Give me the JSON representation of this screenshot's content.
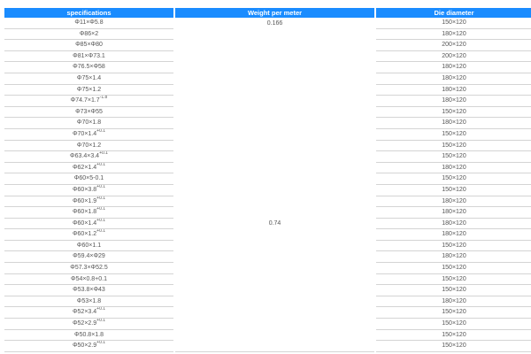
{
  "table": {
    "headers": [
      "specifications",
      "Weight per meter",
      "Die diameter"
    ],
    "rows": [
      {
        "spec": "Φ11×Φ5.8",
        "sup": "",
        "weight": "0.166",
        "die": "150×120"
      },
      {
        "spec": "Φ86×2",
        "sup": "",
        "weight": "",
        "die": "180×120"
      },
      {
        "spec": "Φ85×Φ80",
        "sup": "",
        "weight": "",
        "die": "200×120"
      },
      {
        "spec": "Φ81×Φ73.1",
        "sup": "",
        "weight": "",
        "die": "200×120"
      },
      {
        "spec": "Φ76.5×Φ58",
        "sup": "",
        "weight": "",
        "die": "180×120"
      },
      {
        "spec": "Φ75×1.4",
        "sup": "",
        "weight": "",
        "die": "180×120"
      },
      {
        "spec": "Φ75×1.2",
        "sup": "",
        "weight": "",
        "die": "180×120"
      },
      {
        "spec": "Φ74.7×1.7",
        "sup": "-1.8",
        "weight": "",
        "die": "180×120"
      },
      {
        "spec": "Φ73×Φ55",
        "sup": "",
        "weight": "",
        "die": "150×120"
      },
      {
        "spec": "Φ70×1.8",
        "sup": "",
        "weight": "",
        "die": "180×120"
      },
      {
        "spec": "Φ70×1.4",
        "sup": "+0.1",
        "weight": "",
        "die": "150×120"
      },
      {
        "spec": "Φ70×1.2",
        "sup": "",
        "weight": "",
        "die": "150×120"
      },
      {
        "spec": "Φ63.4×3.4",
        "sup": "+0.1",
        "weight": "",
        "die": "150×120"
      },
      {
        "spec": "Φ62×1.4",
        "sup": "+0.1",
        "weight": "",
        "die": "180×120"
      },
      {
        "spec": "Φ60×5-0.1",
        "sup": "",
        "weight": "",
        "die": "150×120"
      },
      {
        "spec": "Φ60×3.8",
        "sup": "+0.1",
        "weight": "",
        "die": "150×120"
      },
      {
        "spec": "Φ60×1.9",
        "sup": "+0.1",
        "weight": "",
        "die": "180×120"
      },
      {
        "spec": "Φ60×1.8",
        "sup": "+0.1",
        "weight": "",
        "die": "180×120"
      },
      {
        "spec": "Φ60×1.4",
        "sup": "+0.1",
        "weight": "0.74",
        "die": "180×120"
      },
      {
        "spec": "Φ60×1.2",
        "sup": "+0.1",
        "weight": "",
        "die": "180×120"
      },
      {
        "spec": "Φ60×1.1",
        "sup": "",
        "weight": "",
        "die": "150×120"
      },
      {
        "spec": "Φ59.4×Φ29",
        "sup": "",
        "weight": "",
        "die": "180×120"
      },
      {
        "spec": "Φ57.3×Φ52.5",
        "sup": "",
        "weight": "",
        "die": "150×120"
      },
      {
        "spec": "Φ54×0.8+0.1",
        "sup": "",
        "weight": "",
        "die": "150×120"
      },
      {
        "spec": "Φ53.8×Φ43",
        "sup": "",
        "weight": "",
        "die": "150×120"
      },
      {
        "spec": "Φ53×1.8",
        "sup": "",
        "weight": "",
        "die": "180×120"
      },
      {
        "spec": "Φ52×3.4",
        "sup": "+0.1",
        "weight": "",
        "die": "150×120"
      },
      {
        "spec": "Φ52×2.9",
        "sup": "+0.1",
        "weight": "",
        "die": "150×120"
      },
      {
        "spec": "Φ50.8×1.8",
        "sup": "",
        "weight": "",
        "die": "150×120"
      },
      {
        "spec": "Φ50×2.9",
        "sup": "+0.1",
        "weight": "",
        "die": "150×120"
      }
    ]
  },
  "colors": {
    "header_bg": "#1a8cff",
    "header_text": "#ffffff",
    "cell_text": "#555555",
    "row_border": "#d4d4d4"
  }
}
